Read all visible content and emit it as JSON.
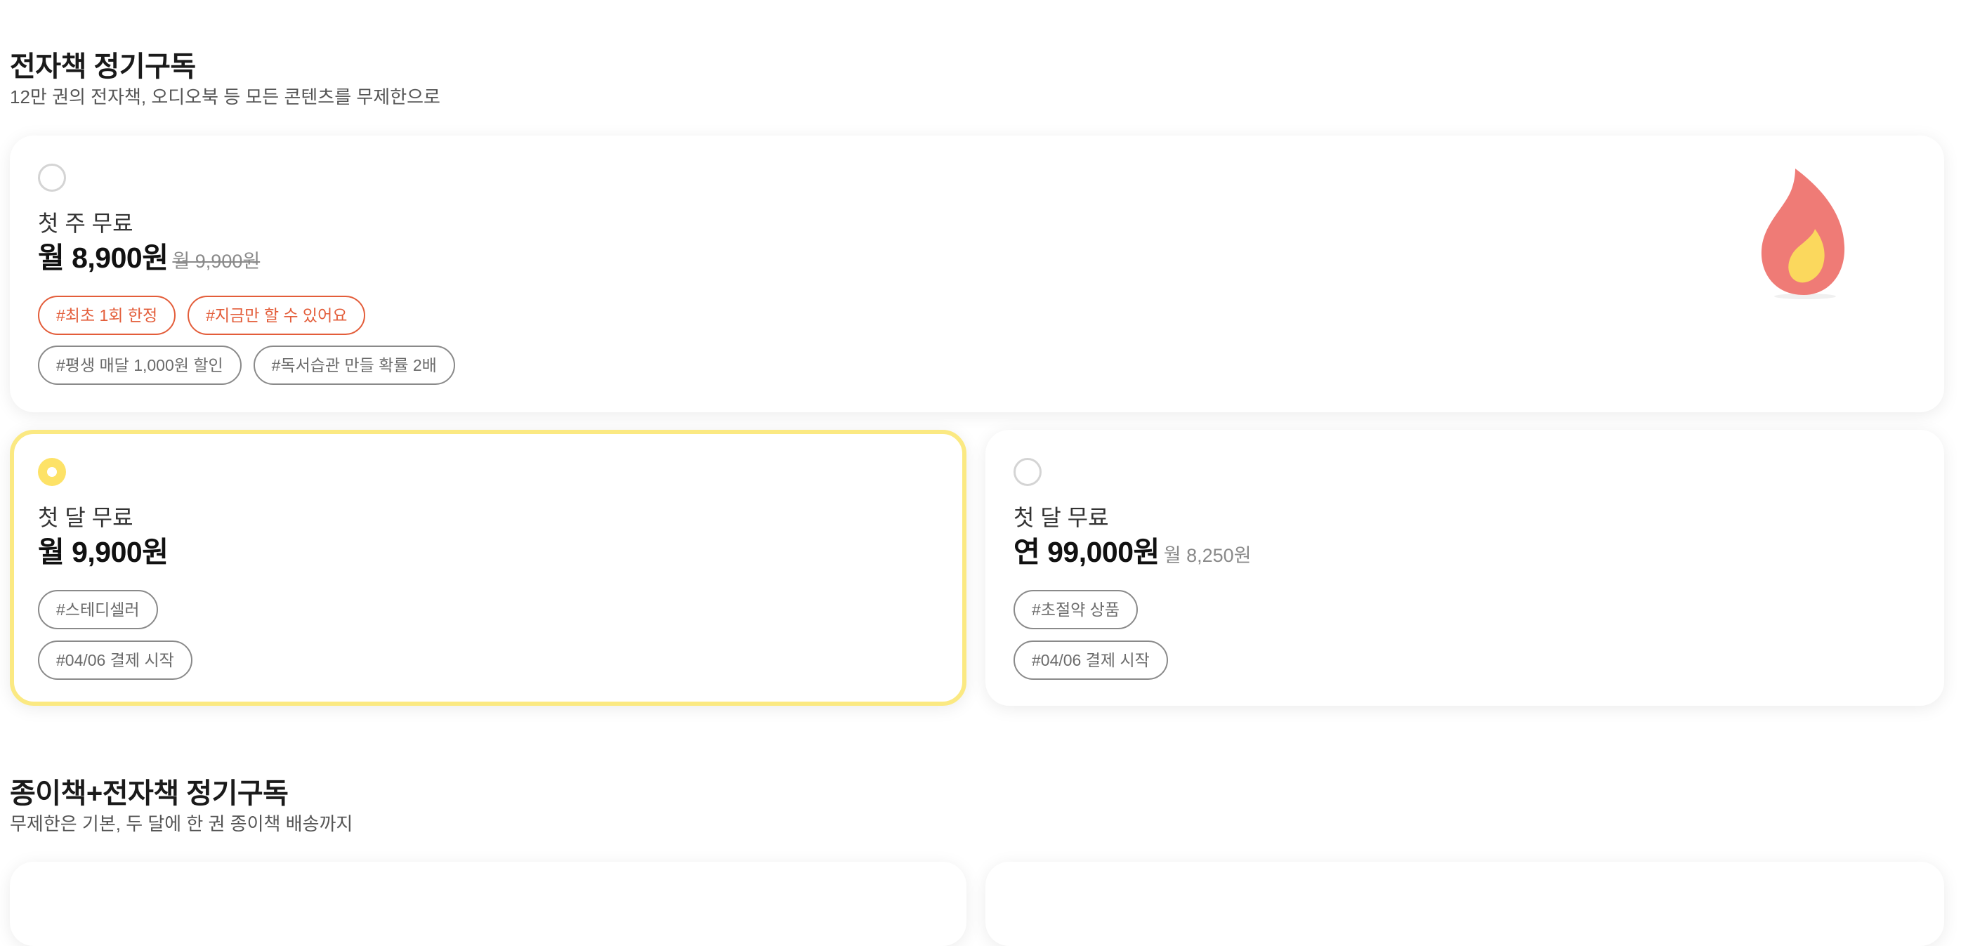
{
  "ebook_section": {
    "title": "전자책 정기구독",
    "subtitle": "12만 권의 전자책, 오디오북 등 모든 콘텐츠를 무제한으로",
    "plans": [
      {
        "label": "첫 주 무료",
        "price": "월 8,900원",
        "original_price": "월 9,900원",
        "selected": false,
        "highlight_tags": [
          "#최초 1회 한정",
          "#지금만 할 수 있어요"
        ],
        "tags": [
          "#평생 매달 1,000원 할인",
          "#독서습관 만들 확률 2배"
        ],
        "icon": "flame-icon"
      },
      {
        "label": "첫 달 무료",
        "price": "월 9,900원",
        "selected": true,
        "tags": [
          "#스테디셀러"
        ],
        "tags2": [
          "#04/06 결제 시작"
        ]
      },
      {
        "label": "첫 달 무료",
        "price": "연 99,000원",
        "monthly_price": "월 8,250원",
        "selected": false,
        "tags": [
          "#초절약 상품"
        ],
        "tags2": [
          "#04/06 결제 시작"
        ]
      }
    ]
  },
  "paper_section": {
    "title": "종이책+전자책 정기구독",
    "subtitle": "무제한은 기본, 두 달에 한 권 종이책 배송까지"
  },
  "colors": {
    "selected_border": "#fbe982",
    "radio_checked": "#fde267",
    "hot_tag": "#e35d3a",
    "flame_outer": "#ef7b76",
    "flame_inner": "#fbd85d"
  }
}
